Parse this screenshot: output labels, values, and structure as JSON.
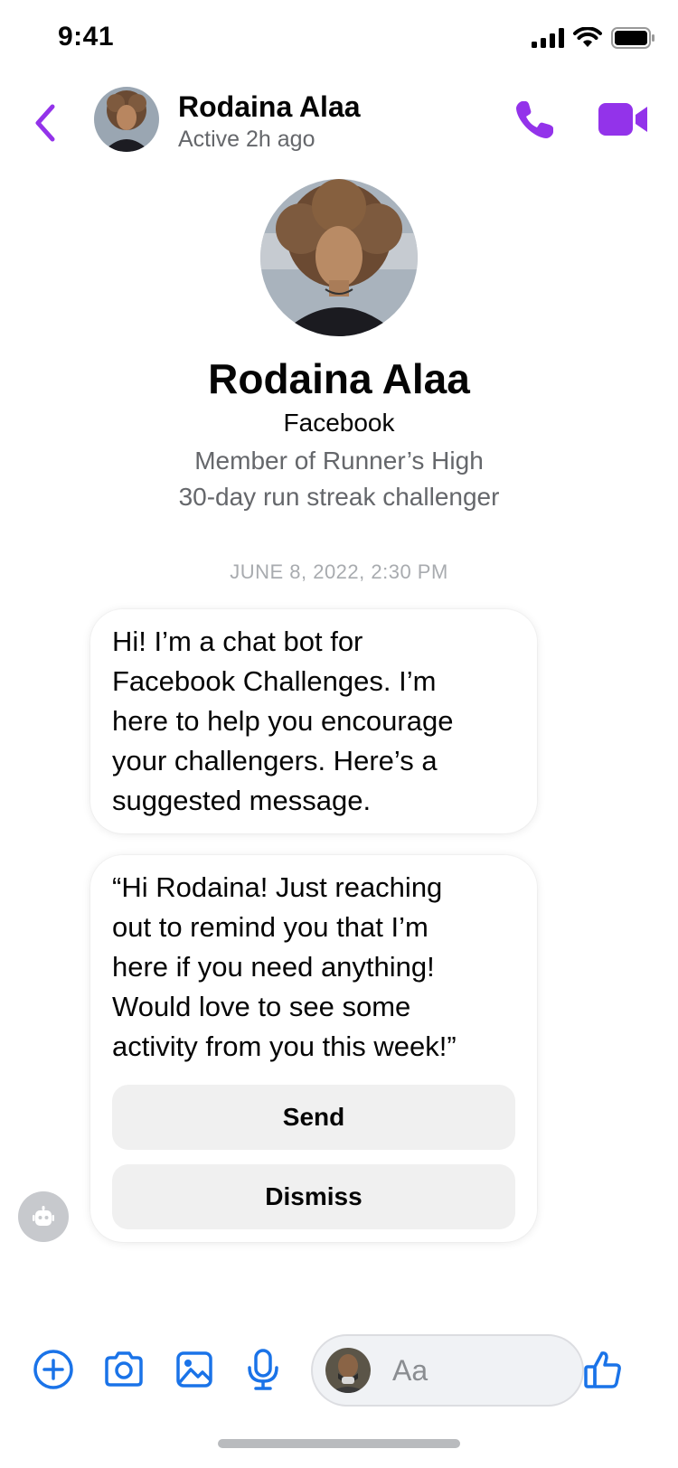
{
  "status_bar": {
    "time": "9:41"
  },
  "header": {
    "name": "Rodaina Alaa",
    "status": "Active 2h ago",
    "icons": {
      "back": "chevron-left-icon",
      "call": "phone-icon",
      "video": "video-camera-icon"
    }
  },
  "profile": {
    "name": "Rodaina Alaa",
    "platform": "Facebook",
    "lines": [
      "Member of Runner’s High",
      "30-day run streak challenger"
    ]
  },
  "conversation": {
    "timestamp": "JUNE 8, 2022, 2:30 PM",
    "messages": [
      {
        "text": "Hi! I’m a chat bot for\nFacebook Challenges. I’m\nhere to help you encourage\nyour challengers. Here’s a\nsuggested message."
      },
      {
        "text": "“Hi Rodaina! Just reaching\nout to remind you that I’m\nhere if you need anything!\nWould love to see some\nactivity from you this week!”"
      }
    ],
    "actions": {
      "send": "Send",
      "dismiss": "Dismiss"
    }
  },
  "composer": {
    "placeholder": "Aa",
    "icons": [
      "plus-circle-icon",
      "camera-icon",
      "image-icon",
      "microphone-icon",
      "thumbs-up-icon"
    ]
  },
  "colors": {
    "accent": "#9333ea",
    "composer_blue": "#1a73e8"
  }
}
